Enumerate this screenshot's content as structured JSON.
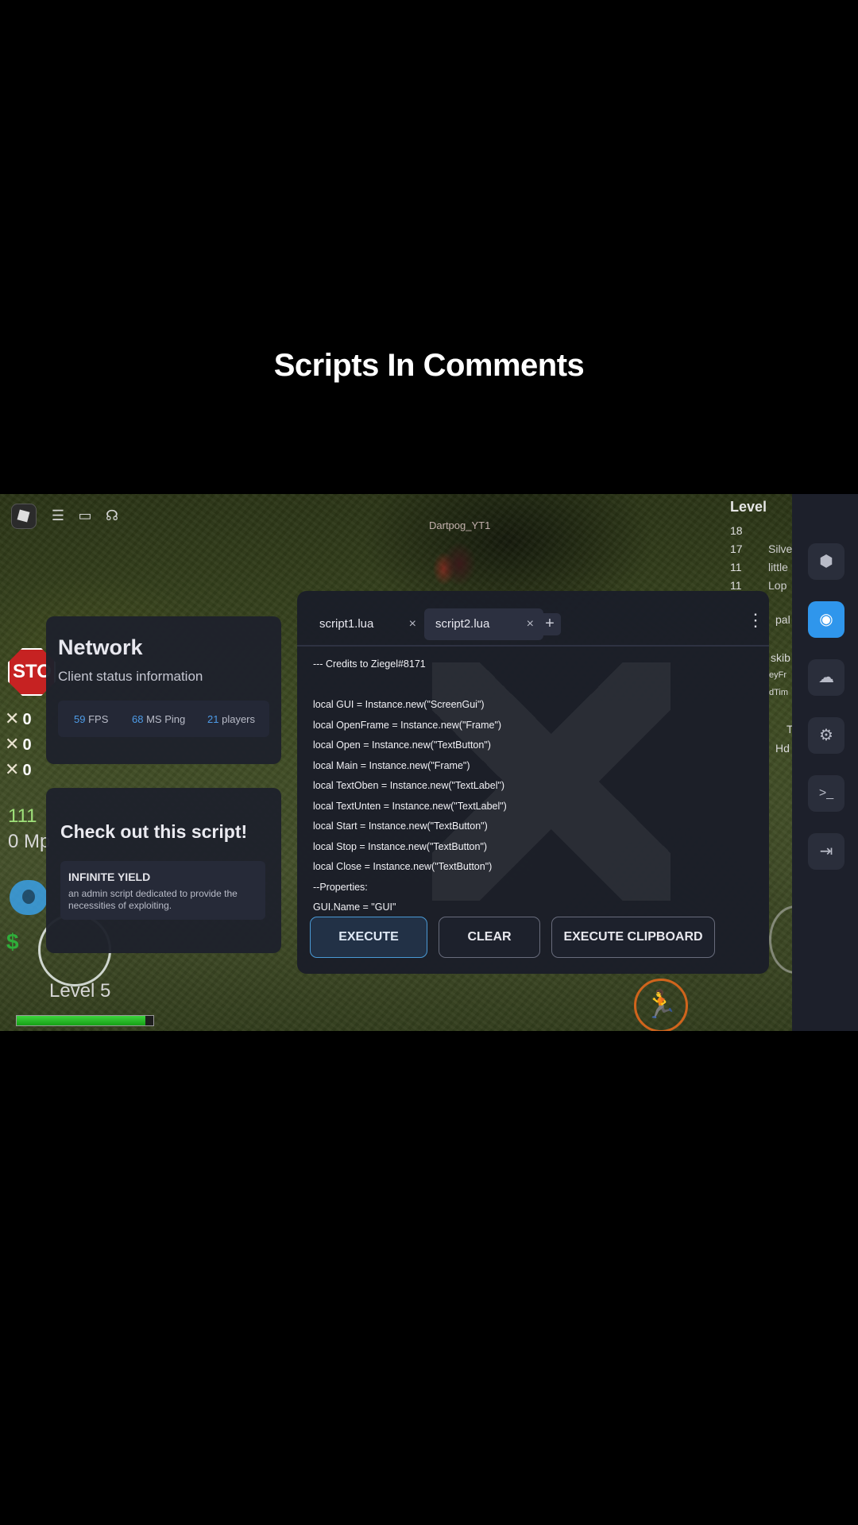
{
  "caption": "Scripts In Comments",
  "game": {
    "player_name": "Dartpog_YT1",
    "leaderboard_title": "Level",
    "leaderboard": [
      {
        "level": "18",
        "name": ""
      },
      {
        "level": "17",
        "name": "Silve"
      },
      {
        "level": "11",
        "name": "little"
      },
      {
        "level": "11",
        "name": "Lop"
      }
    ],
    "side_texts": [
      "pal",
      "skib",
      "eyFr",
      "dTim",
      "T",
      "Hd"
    ],
    "stop_label": "STO",
    "bone_counts": [
      "0",
      "0",
      "0"
    ],
    "stat_value": "111",
    "stat_mp": "0 Mp",
    "currency_symbol": "$",
    "level_label": "Level 5",
    "xp_progress": 0.94
  },
  "network": {
    "title": "Network",
    "subtitle": "Client status information",
    "fps_value": "59",
    "fps_label": "FPS",
    "ping_value": "68",
    "ping_label": "MS Ping",
    "players_value": "21",
    "players_label": "players"
  },
  "script_promo": {
    "title": "Check out this script!",
    "name": "INFINITE YIELD",
    "description": "an admin script dedicated to provide the necessities of exploiting."
  },
  "editor": {
    "tabs": [
      {
        "label": "script1.lua",
        "close": "×"
      },
      {
        "label": "script2.lua",
        "close": "×"
      }
    ],
    "add_tab": "+",
    "menu": "⋮",
    "code_lines": [
      "--- Credits to Ziegel#8171",
      "",
      "local GUI = Instance.new(\"ScreenGui\")",
      "local OpenFrame = Instance.new(\"Frame\")",
      "local Open = Instance.new(\"TextButton\")",
      "local Main = Instance.new(\"Frame\")",
      "local TextOben = Instance.new(\"TextLabel\")",
      "local TextUnten = Instance.new(\"TextLabel\")",
      "local Start = Instance.new(\"TextButton\")",
      "local Stop = Instance.new(\"TextButton\")",
      "local Close = Instance.new(\"TextButton\")",
      "--Properties:",
      "GUI.Name = \"GUI\""
    ],
    "execute_label": "EXECUTE",
    "clear_label": "CLEAR",
    "execute_clipboard_label": "EXECUTE CLIPBOARD"
  },
  "sidebar": {
    "items": [
      {
        "name": "shield-icon",
        "glyph": "⬢"
      },
      {
        "name": "gamepad-icon",
        "glyph": "◉"
      },
      {
        "name": "cloud-icon",
        "glyph": "☁"
      },
      {
        "name": "gear-icon",
        "glyph": "⚙"
      },
      {
        "name": "terminal-icon",
        "glyph": ">_"
      },
      {
        "name": "exit-icon",
        "glyph": "⇥"
      }
    ],
    "active_index": 1
  }
}
